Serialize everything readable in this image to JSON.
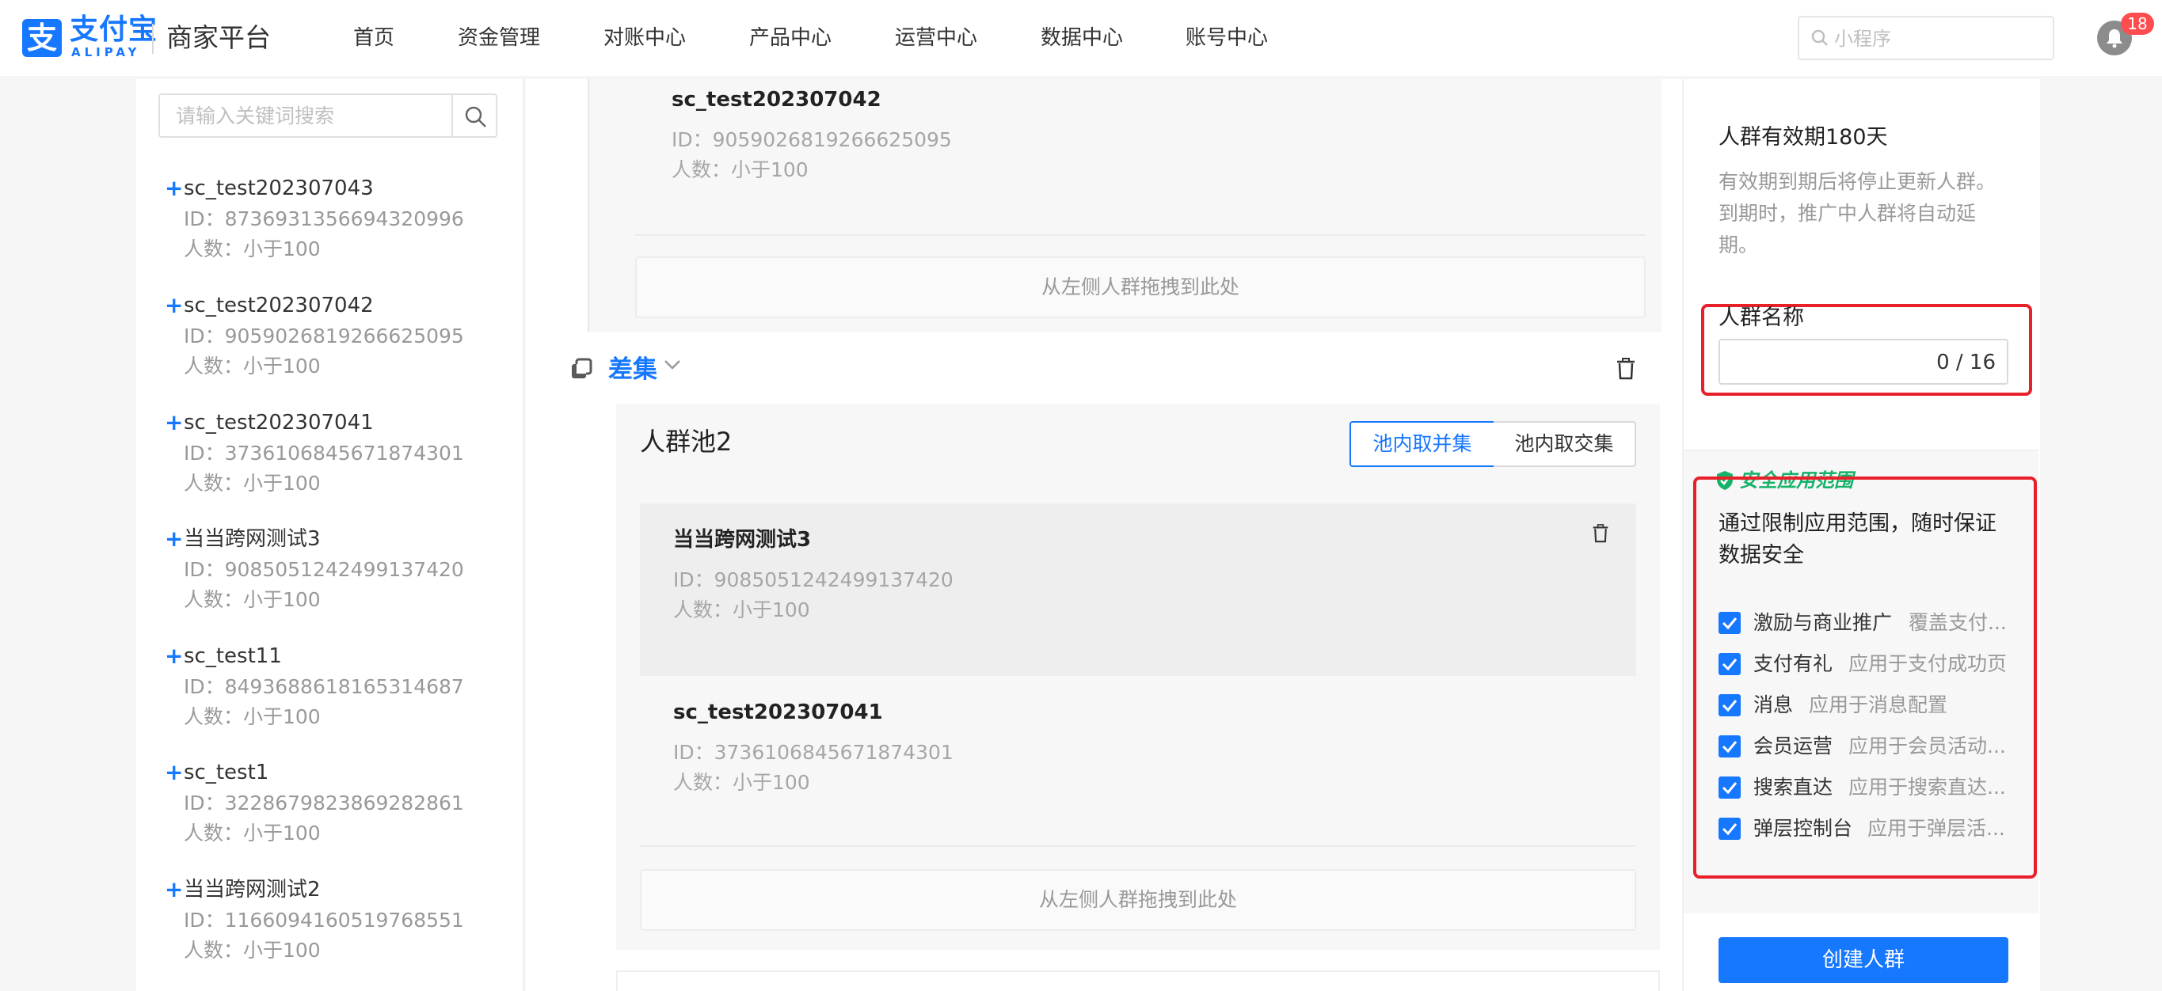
{
  "brand": {
    "mark": "支",
    "name_cn": "支付宝",
    "name_en": "ALIPAY",
    "platform": "商家平台",
    "color": "#1677ff"
  },
  "nav": [
    {
      "label": "首页"
    },
    {
      "label": "资金管理"
    },
    {
      "label": "对账中心"
    },
    {
      "label": "产品中心"
    },
    {
      "label": "运营中心"
    },
    {
      "label": "数据中心"
    },
    {
      "label": "账号中心"
    }
  ],
  "top_search": {
    "placeholder": "小程序"
  },
  "notifications": {
    "count": "18"
  },
  "left_panel": {
    "search_placeholder": "请输入关键词搜索",
    "crowds": [
      {
        "name": "sc_test202307043",
        "id": "ID：8736931356694320996",
        "count": "人数：小于100"
      },
      {
        "name": "sc_test202307042",
        "id": "ID：9059026819266625095",
        "count": "人数：小于100"
      },
      {
        "name": "sc_test202307041",
        "id": "ID：3736106845671874301",
        "count": "人数：小于100"
      },
      {
        "name": "当当跨网测试3",
        "id": "ID：9085051242499137420",
        "count": "人数：小于100"
      },
      {
        "name": "sc_test11",
        "id": "ID：8493688618165314687",
        "count": "人数：小于100"
      },
      {
        "name": "sc_test1",
        "id": "ID：3228679823869282861",
        "count": "人数：小于100"
      },
      {
        "name": "当当跨网测试2",
        "id": "ID：1166094160519768551",
        "count": "人数：小于100"
      }
    ]
  },
  "main": {
    "pool1": {
      "item": {
        "name": "sc_test202307042",
        "id": "ID：9059026819266625095",
        "count": "人数：小于100"
      },
      "dropzone": "从左侧人群拖拽到此处"
    },
    "operator": {
      "label": "差集"
    },
    "pool2": {
      "title": "人群池2",
      "modes": [
        {
          "label": "池内取并集",
          "active": true
        },
        {
          "label": "池内取交集",
          "active": false
        }
      ],
      "items": [
        {
          "name": "当当跨网测试3",
          "id": "ID：9085051242499137420",
          "count": "人数：小于100"
        },
        {
          "name": "sc_test202307041",
          "id": "ID：3736106845671874301",
          "count": "人数：小于100"
        }
      ],
      "dropzone": "从左侧人群拖拽到此处"
    }
  },
  "right_panel": {
    "validity_title": "人群有效期180天",
    "validity_desc": "有效期到期后将停止更新人群。到期时，推广中人群将自动延期。",
    "name_label": "人群名称",
    "name_counter": "0 / 16",
    "safe_title": "安全应用范围",
    "safe_desc": "通过限制应用范围，随时保证数据安全",
    "permissions": [
      {
        "label": "激励与商业推广",
        "desc": "覆盖支付...",
        "checked": true
      },
      {
        "label": "支付有礼",
        "desc": "应用于支付成功页",
        "checked": true
      },
      {
        "label": "消息",
        "desc": "应用于消息配置",
        "checked": true
      },
      {
        "label": "会员运营",
        "desc": "应用于会员活动...",
        "checked": true
      },
      {
        "label": "搜索直达",
        "desc": "应用于搜索直达...",
        "checked": true
      },
      {
        "label": "弹层控制台",
        "desc": "应用于弹层活...",
        "checked": true
      }
    ],
    "create_label": "创建人群",
    "highlight_color": "#e8202a",
    "safe_color": "#17b26a"
  }
}
